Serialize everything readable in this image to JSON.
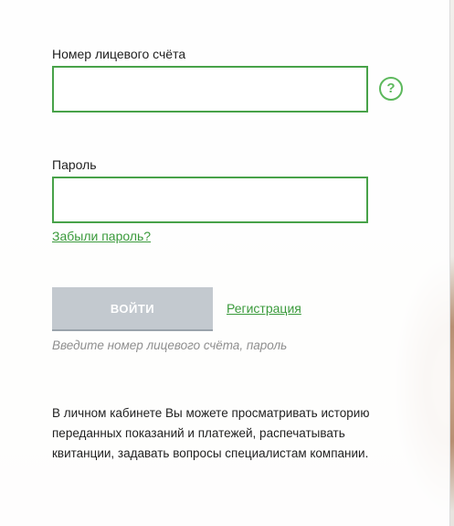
{
  "login": {
    "account_label": "Номер лицевого счёта",
    "account_value": "",
    "password_label": "Пароль",
    "password_value": "",
    "forgot_link": "Забыли пароль?",
    "help_icon": "question-circle-icon",
    "submit_label": "ВОЙТИ",
    "register_link": "Регистрация",
    "hint": "Введите номер лицевого счёта, пароль"
  },
  "info": {
    "lines": [
      "В личном кабинете Вы можете просматривать историю",
      "переданных показаний и платежей, распечатывать",
      "квитанции, задавать вопросы специалистам компании."
    ]
  },
  "colors": {
    "accent_green": "#48a249",
    "link_green": "#3a9a3b",
    "button_disabled": "#c3c9cf",
    "hint_gray": "#8f8f8f"
  }
}
